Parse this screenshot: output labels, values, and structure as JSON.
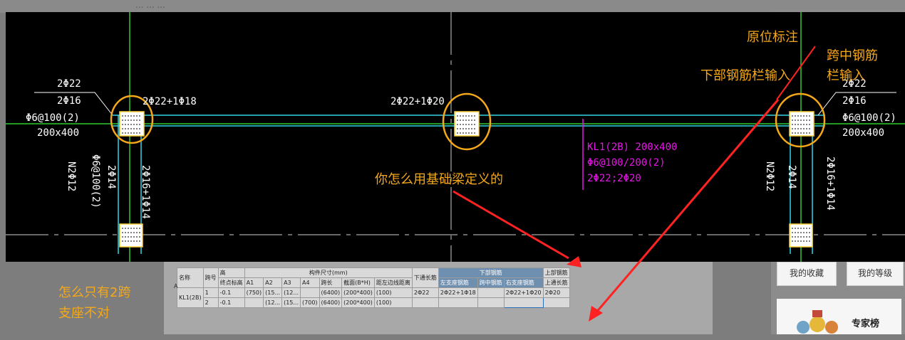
{
  "top_hint": "...   ...  ...",
  "cad": {
    "left_rebar": [
      "2Φ22",
      "2Φ16",
      "Φ6@100(2)",
      "200x400"
    ],
    "right_rebar": [
      "2Φ22",
      "2Φ16",
      "Φ6@100(2)",
      "200x400"
    ],
    "span1_bottom": "2Φ22+1Φ18",
    "span2_bottom": "2Φ22+1Φ20",
    "beam_label": [
      "KL1(2B) 200x400",
      "Φ6@100/200(2)",
      "2Φ22;2Φ20"
    ],
    "vert_left": [
      "2Φ14",
      "2Φ16+1Φ14",
      "Φ6@100(2)",
      "N2Φ12"
    ],
    "vert_right": [
      "2Φ14",
      "2Φ16+1Φ14",
      "N2Φ12"
    ]
  },
  "annotations": {
    "in_situ": "原位标注",
    "bottom_bar_input": "下部钢筋栏输入",
    "midspan_line1": "跨中钢筋",
    "midspan_line2": "栏输入",
    "question": "你怎么用基础梁定义的",
    "only_two_line1": "怎么只有2跨",
    "only_two_line2": "支座不对"
  },
  "table": {
    "header1": [
      "名称",
      "跨号",
      "高",
      "构件尺寸(mm)",
      "下通长筋",
      "下部钢筋",
      "上部钢筋"
    ],
    "header2": [
      "终点标高",
      "A1",
      "A2",
      "A3",
      "A4",
      "跨长",
      "截面(B*H)",
      "距左边线距离",
      "左支座钢筋",
      "跨中钢筋",
      "右支座钢筋",
      "上通长筋"
    ],
    "rows": [
      [
        "KL1(2B)",
        "1",
        "-0.1",
        "(750)",
        "(15...",
        "(12...",
        "",
        "(6400)",
        "(200*400)",
        "(100)",
        "2Φ22",
        "2Φ22+1Φ18",
        "",
        "2Φ22+1Φ20",
        "2Φ20"
      ],
      [
        "",
        "2",
        "-0.1",
        "",
        "(12...",
        "(15...",
        "(700)",
        "(6400)",
        "(200*400)",
        "(100)",
        "",
        "",
        "",
        "",
        ""
      ]
    ],
    "row_marker": "A"
  },
  "right_panel": {
    "my_favorites": "我的收藏",
    "my_level": "我的等级",
    "experts": "专家榜"
  }
}
